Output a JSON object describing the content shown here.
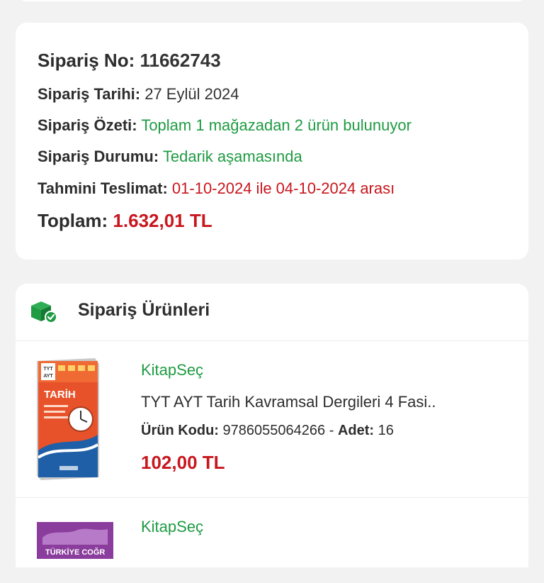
{
  "order": {
    "no_label": "Sipariş No:",
    "no_value": "11662743",
    "date_label": "Sipariş Tarihi:",
    "date_value": "27 Eylül 2024",
    "summary_label": "Sipariş Özeti:",
    "summary_value": "Toplam 1 mağazadan 2 ürün bulunuyor",
    "status_label": "Sipariş Durumu:",
    "status_value": "Tedarik aşamasında",
    "delivery_label": "Tahmini Teslimat:",
    "delivery_value": "01-10-2024 ile 04-10-2024 arası",
    "total_label": "Toplam:",
    "total_value": "1.632,01 TL"
  },
  "products": {
    "title": "Sipariş Ürünleri",
    "icon": "box-check-icon",
    "items": [
      {
        "store": "KitapSeç",
        "name": "TYT AYT Tarih Kavramsal Dergileri 4 Fasi..",
        "code_label": "Ürün Kodu:",
        "code_value": "9786055064266",
        "separator": "-",
        "qty_label": "Adet:",
        "qty_value": "16",
        "price": "102,00 TL",
        "cover_text": {
          "line1": "TYT",
          "line2": "AYT",
          "title": "TARİH"
        }
      },
      {
        "store": "KitapSeç",
        "cover_text": {
          "title": "TÜRKİYE COĞR"
        }
      }
    ]
  },
  "colors": {
    "green": "#1f9b43",
    "red": "#c8161d",
    "background": "#f2f2f2"
  }
}
